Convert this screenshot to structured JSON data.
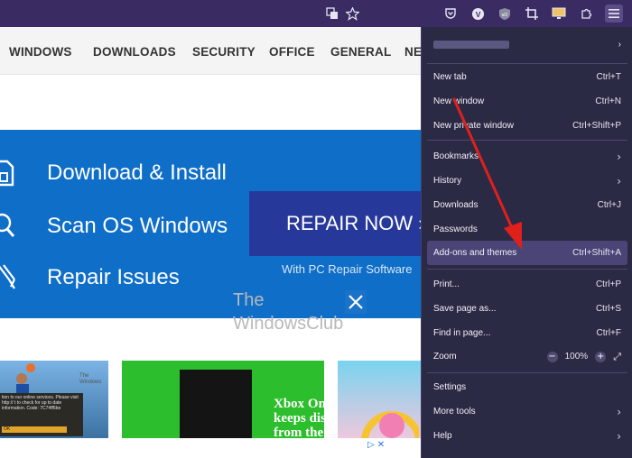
{
  "toolbar": {
    "icons": [
      "translate-icon",
      "star-icon",
      "pocket-icon",
      "vivaldi-icon",
      "shield-extension-icon",
      "crop-icon",
      "monitor-extension-icon",
      "puzzle-extensions-icon",
      "hamburger-menu-icon"
    ]
  },
  "nav": {
    "items": [
      "WINDOWS",
      "DOWNLOADS",
      "SECURITY",
      "OFFICE",
      "GENERAL",
      "NE"
    ]
  },
  "banner": {
    "row1": "Download & Install",
    "row2": "Scan OS Windows",
    "row3": "Repair Issues",
    "button": "REPAIR NOW ›",
    "caption": "With PC Repair Software"
  },
  "watermark": {
    "line1": "The",
    "line2": "WindowsClub"
  },
  "thumbs": {
    "t1_dialog": "tion to our online services. Please visit http:// t to check for up to date information. Code: 7C74ff5be",
    "t1_ok": "OK",
    "t1_wm": "The Windows",
    "t2_text1": "Xbox One",
    "t2_text2": "keeps disconne",
    "t2_text3": "from the inte"
  },
  "menu": {
    "account_chevron": "›",
    "items": [
      {
        "label": "New tab",
        "shortcut": "Ctrl+T"
      },
      {
        "label": "New window",
        "shortcut": "Ctrl+N"
      },
      {
        "label": "New private window",
        "shortcut": "Ctrl+Shift+P"
      },
      {
        "label": "Bookmarks",
        "shortcut": ""
      },
      {
        "label": "History",
        "shortcut": ""
      },
      {
        "label": "Downloads",
        "shortcut": "Ctrl+J"
      },
      {
        "label": "Passwords",
        "shortcut": ""
      },
      {
        "label": "Add-ons and themes",
        "shortcut": "Ctrl+Shift+A"
      },
      {
        "label": "Print...",
        "shortcut": "Ctrl+P"
      },
      {
        "label": "Save page as...",
        "shortcut": "Ctrl+S"
      },
      {
        "label": "Find in page...",
        "shortcut": "Ctrl+F"
      },
      {
        "label": "Zoom",
        "shortcut": ""
      },
      {
        "label": "Settings",
        "shortcut": ""
      },
      {
        "label": "More tools",
        "shortcut": ""
      },
      {
        "label": "Help",
        "shortcut": ""
      }
    ],
    "zoom": {
      "minus": "−",
      "level": "100%",
      "plus": "+"
    }
  },
  "colors": {
    "toolbar": "#3a2c63",
    "menu_bg": "#2b2a45",
    "menu_highlight": "#4b4577",
    "banner_blue": "#0f6ec8",
    "repair_button": "#27389b",
    "arrow_red": "#e0201b"
  }
}
